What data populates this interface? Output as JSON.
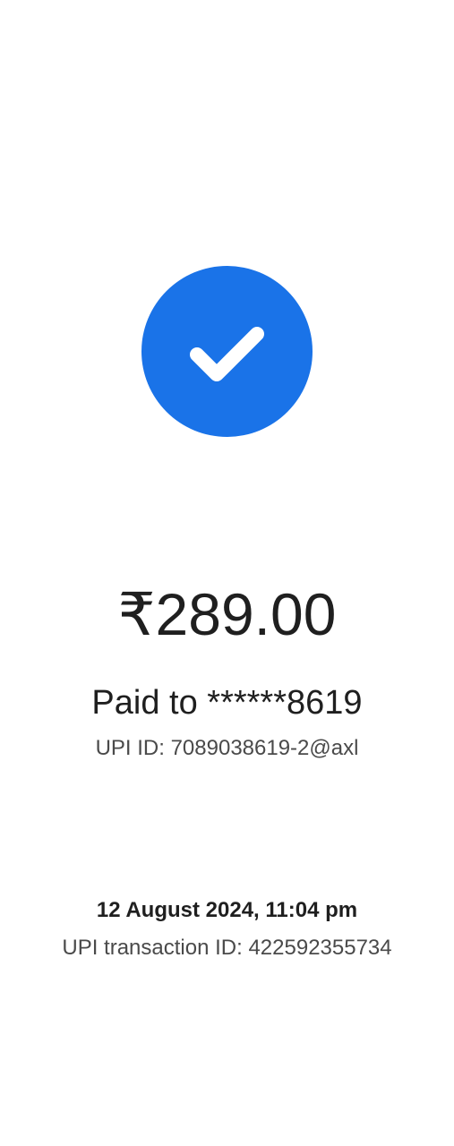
{
  "status": {
    "icon": "check-icon",
    "circle_color": "#1a73e8",
    "check_color": "#ffffff"
  },
  "payment": {
    "amount": "₹289.00",
    "paid_to": "Paid to ******8619",
    "upi_id": "UPI ID: 7089038619-2@axl"
  },
  "transaction": {
    "datetime": "12 August 2024, 11:04 pm",
    "txn_id": "UPI transaction ID: 422592355734"
  }
}
